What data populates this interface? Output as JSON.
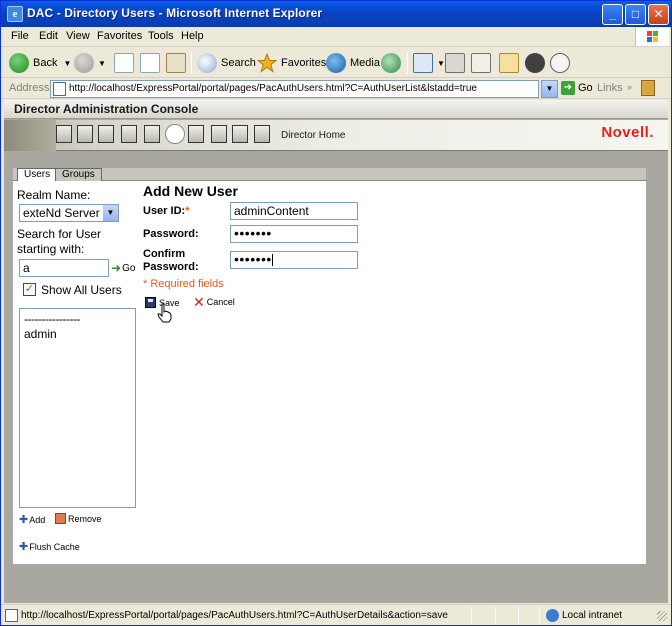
{
  "window": {
    "title": "DAC - Directory Users - Microsoft Internet Explorer",
    "app_icon": "ie-page-icon",
    "controls": [
      "minimize",
      "maximize",
      "close"
    ]
  },
  "menu": [
    "File",
    "Edit",
    "View",
    "Favorites",
    "Tools",
    "Help"
  ],
  "toolbar": {
    "back": "Back",
    "forward": "",
    "search": "Search",
    "favorites": "Favorites",
    "media": "Media"
  },
  "address": {
    "label": "Address",
    "url": "http://localhost/ExpressPortal/portal/pages/PacAuthUsers.html?C=AuthUserList&lstadd=true",
    "go": "Go",
    "links": "Links"
  },
  "dac": {
    "header_title": "Director Administration Console",
    "home_label": "Director Home",
    "brand": "Novell.",
    "brand_color": "#e2231a",
    "nav_icons": [
      "portal-icon",
      "calculator-icon",
      "users-icon",
      "id-icon",
      "edit-icon",
      "security-icon",
      "grid-icon",
      "page-icon",
      "workflow-icon",
      "home-icon"
    ]
  },
  "tabs": [
    {
      "label": "Users",
      "active": true
    },
    {
      "label": "Groups",
      "active": false
    }
  ],
  "sidebar": {
    "realm_label": "Realm Name:",
    "realm_value": "exteNd Server",
    "search_label_1": "Search for User",
    "search_label_2": "starting with:",
    "search_value": "a",
    "go_label": "Go",
    "show_all_label": "Show All Users",
    "show_all_checked": true,
    "list_separator": "----------------",
    "users": [
      "admin"
    ],
    "add_label": "Add",
    "remove_label": "Remove",
    "flush_label": "Flush Cache"
  },
  "form": {
    "title": "Add New User",
    "userid_label": "User ID:",
    "userid_required": "*",
    "userid_value": "adminContent",
    "password_label": "Password:",
    "password_value": "•••••••",
    "confirm_label_1": "Confirm",
    "confirm_label_2": "Password:",
    "confirm_value": "•••••••",
    "required_note": "* Required fields",
    "required_color": "#e05a1a",
    "save_label": "Save",
    "cancel_label": "Cancel"
  },
  "status": {
    "text": "http://localhost/ExpressPortal/portal/pages/PacAuthUsers.html?C=AuthUserDetails&action=save",
    "zone": "Local intranet"
  }
}
